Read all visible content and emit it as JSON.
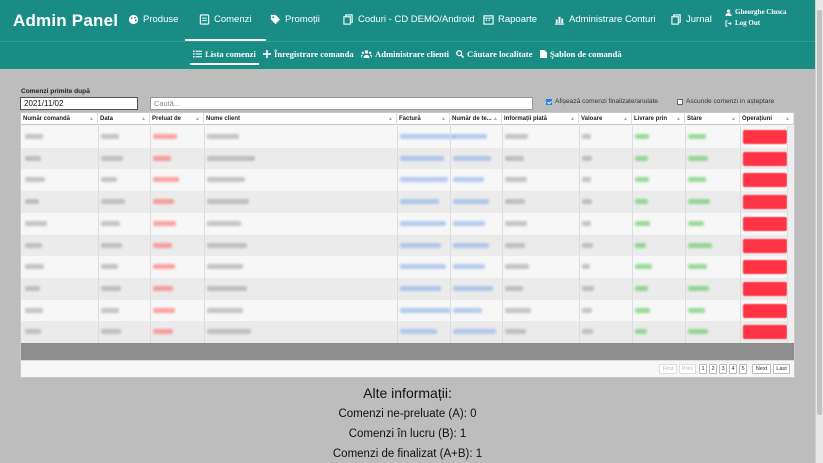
{
  "brand": "Admin Panel",
  "nav": [
    {
      "label": "Produse",
      "icon": "palette-icon"
    },
    {
      "label": "Comenzi",
      "icon": "receipt-icon"
    },
    {
      "label": "Promoții",
      "icon": "tag-icon"
    },
    {
      "label": "Coduri - CD DEMO/Android",
      "icon": "copy-icon"
    },
    {
      "label": "Rapoarte",
      "icon": "calendar-icon"
    },
    {
      "label": "Administrare Conturi",
      "icon": "chart-icon"
    },
    {
      "label": "Jurnal",
      "icon": "copy-icon"
    }
  ],
  "user": {
    "name": "Gheorghe Ciusca",
    "logout": "Log Out"
  },
  "subnav": [
    {
      "label": "Lista comenzi",
      "icon": "list-icon"
    },
    {
      "label": "Înregistrare comanda",
      "icon": "plus-icon"
    },
    {
      "label": "Administrare clienti",
      "icon": "users-icon"
    },
    {
      "label": "Căutare localitate",
      "icon": "search-icon"
    },
    {
      "label": "Şablon de comandă",
      "icon": "file-icon"
    }
  ],
  "filter": {
    "date_label": "Comenzi primite după",
    "date_value": "2021/11/02",
    "search_placeholder": "Caută...",
    "show_finished_label": "Afișează comenzi finalizate/anulate",
    "show_finished_checked": true,
    "hide_waiting_label": "Ascunde comenzi in așteptare",
    "hide_waiting_checked": false
  },
  "table": {
    "columns": [
      "Număr comandă",
      "Data",
      "Preluat de",
      "Nume client",
      "Factură",
      "Număr de te...",
      "Informații plată",
      "Valoare",
      "Livrare prin",
      "Stare",
      "Operațiuni"
    ],
    "row_count": 10
  },
  "pager": {
    "first": "First",
    "prev": "Prev",
    "pages": [
      "1",
      "2",
      "3",
      "4",
      "5"
    ],
    "next": "Next",
    "last": "Last"
  },
  "info": {
    "title": "Alte informații:",
    "lines": [
      "Comenzi ne-preluate (A): 0",
      "Comenzi în lucru (B): 1",
      "Comenzi de finalizat (A+B): 1"
    ]
  },
  "colors": {
    "header": "#1a8c86",
    "operation_button": "#ff3344",
    "taken_by_text": "#ff5a5a",
    "invoice_text": "#7fa7e8",
    "delivery_text": "#4cc24c"
  }
}
